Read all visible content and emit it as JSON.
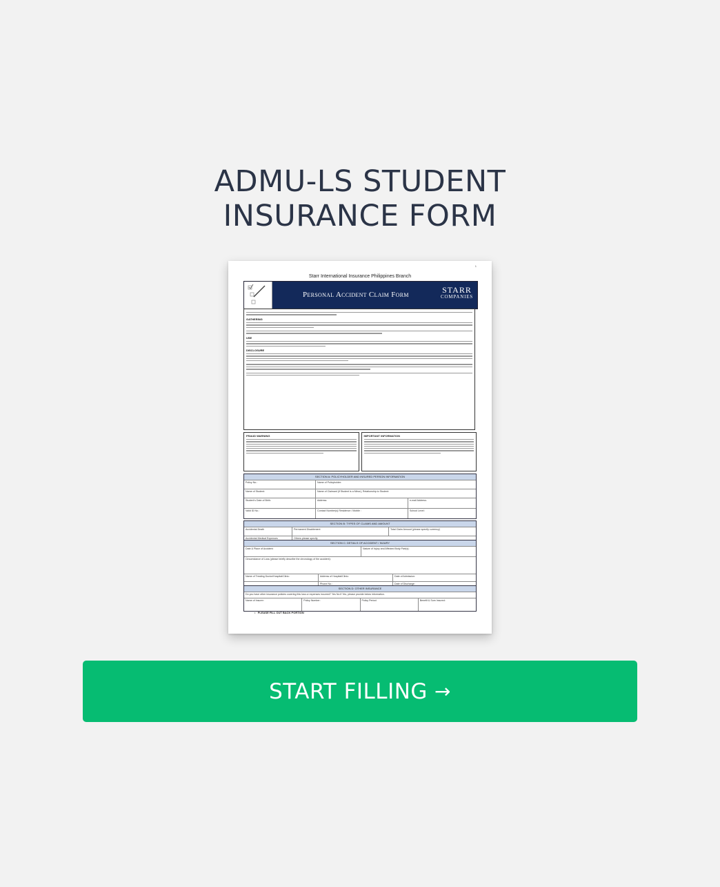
{
  "page": {
    "title_line1": "ADMU-LS STUDENT",
    "title_line2": "INSURANCE FORM"
  },
  "preview": {
    "page_number": "1",
    "company_header": "Starr International Insurance Philippines Branch",
    "form_title": "Personal Accident Claim Form",
    "brand_line1": "STARR",
    "brand_line2": "COMPANIES",
    "privacy_heads": [
      "GATHERING",
      "USE",
      "DISCLOSURE"
    ],
    "fraud_warning_head": "FRAUD WARNING",
    "important_info_head": "IMPORTANT INFORMATION",
    "section_a": "SECTION A: POLICYHOLDER AND INSURED PERSON INFORMATION",
    "section_a_fields": [
      [
        "Policy No.:",
        "Name of Policyholder:"
      ],
      [
        "Name of Student:",
        "Name of Claimant (if Student is a Minor), Relationship to Student:"
      ],
      [
        "Student's Date of Birth:",
        "Address:",
        "e-mail Address:"
      ],
      [
        "Valid ID No.:",
        "Contact Number(s) Residence / Mobile :",
        "School Level:"
      ]
    ],
    "section_b": "SECTION B: TYPES OF CLAIMS AND AMOUNT",
    "section_b_fields": [
      [
        "Accidental Death",
        "Permanent Disablement",
        "Total Claim Amount (please specify currency)"
      ],
      [
        "Accidental Medical Expenses",
        "Others please specify"
      ]
    ],
    "section_c": "SECTION C: DETAILS OF ACCIDENT / INJURY",
    "section_c_fields": [
      [
        "Date & Place of Accident:",
        "Nature of Injury and Affected Body Part(s):"
      ],
      [
        "Circumstance of Loss (please briefly describe the chronology of the accident):"
      ],
      [
        "Name of Treating Doctor/Hospital/Clinic:",
        "Address of Hospital/Clinic:",
        "Date of Admission:"
      ],
      [
        "",
        "Phone No.:",
        "Date of Discharge:"
      ]
    ],
    "section_d": "SECTION D: OTHER INSURANCE",
    "section_d_fields": [
      [
        "Do you have other insurance policies covering this loss or expenses incurred?   Yes   No   If Yes, please provide below information."
      ],
      [
        "Name of Insurer:",
        "Policy Number:",
        "Policy Period:",
        "Benefit & Sum Insured:"
      ]
    ],
    "back_note": "PLEASE FILL OUT BACK PORTION"
  },
  "cta": {
    "label": "START FILLING",
    "arrow": "→"
  },
  "colors": {
    "background": "#f2f2f2",
    "title": "#2b3447",
    "cta": "#06bc72",
    "banner": "#13295a",
    "section_bar": "#c9d6ea"
  }
}
